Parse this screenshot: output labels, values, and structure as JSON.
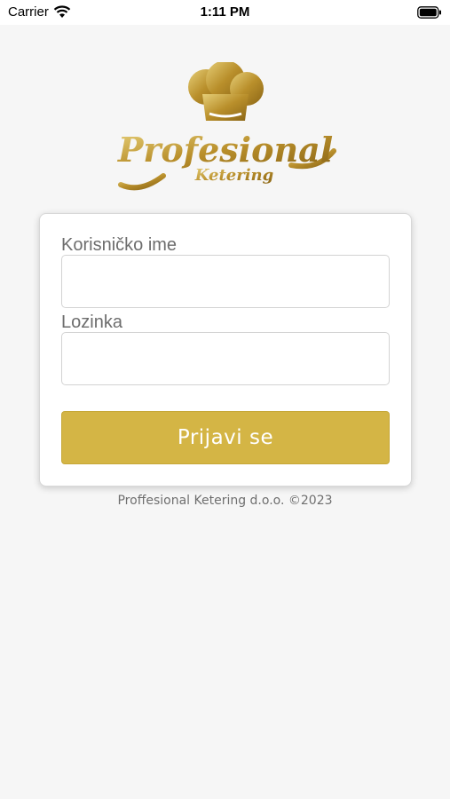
{
  "status_bar": {
    "carrier": "Carrier",
    "time": "1:11 PM",
    "icons": [
      "wifi-icon",
      "battery-icon"
    ]
  },
  "logo": {
    "title": "Profesional",
    "subtitle": "Ketering",
    "icon": "chef-hat-icon",
    "color": "#c9a43f"
  },
  "form": {
    "username_label": "Korisničko ime",
    "username_value": "",
    "password_label": "Lozinka",
    "password_value": "",
    "submit_label": "Prijavi se"
  },
  "footer": {
    "text": "Proffesional Ketering d.o.o. ©2023"
  },
  "colors": {
    "accent": "#d4b545",
    "background": "#f6f6f6",
    "label_text": "#6d6d6d"
  }
}
